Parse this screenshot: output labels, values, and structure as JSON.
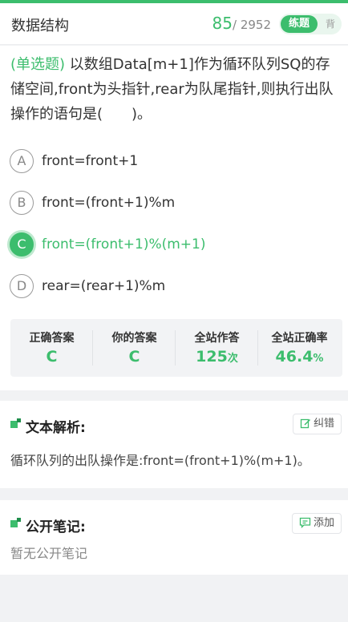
{
  "header": {
    "title": "数据结构",
    "current": "85",
    "total": "/ 2952",
    "mode_active": "练题",
    "mode_inactive": "背"
  },
  "question": {
    "type": "(单选题)",
    "text": " 以数组Data[m+1]作为循环队列SQ的存储空间,front为头指针,rear为队尾指针,则执行出队操作的语句是(　　)。"
  },
  "options": [
    {
      "letter": "A",
      "text": "front=front+1"
    },
    {
      "letter": "B",
      "text": "front=(front+1)%m"
    },
    {
      "letter": "C",
      "text": "front=(front+1)%(m+1)",
      "selected": true
    },
    {
      "letter": "D",
      "text": "rear=(rear+1)%m"
    }
  ],
  "stats": {
    "correct_label": "正确答案",
    "correct_value": "C",
    "yours_label": "你的答案",
    "yours_value": "C",
    "count_label": "全站作答",
    "count_value": "125",
    "count_unit": "次",
    "rate_label": "全站正确率",
    "rate_value": "46.4",
    "rate_unit": "%"
  },
  "analysis": {
    "title": "文本解析:",
    "button": "纠错",
    "text": "循环队列的出队操作是:front=(front+1)%(m+1)。"
  },
  "notes": {
    "title": "公开笔记:",
    "button": "添加",
    "empty": "暂无公开笔记"
  },
  "colors": {
    "accent": "#3cbd6d",
    "background": "#f1f2f4"
  }
}
